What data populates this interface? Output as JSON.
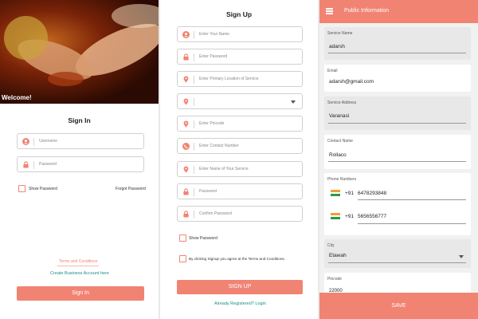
{
  "colors": {
    "accent": "#f18373",
    "link": "#1a8f86"
  },
  "signin": {
    "welcome": "Welcome!",
    "title": "Sign In",
    "username_placeholder": "Username",
    "password_placeholder": "Password",
    "show_password": "Show Password",
    "forgot_password": "Forgot Password",
    "terms_link": "Terms and Conditions",
    "create_account": "Create Business Account here",
    "signin_button": "Sign In"
  },
  "signup": {
    "title": "Sign Up",
    "fields": [
      {
        "icon": "user-icon",
        "placeholder": "Enter Your Name"
      },
      {
        "icon": "lock-icon",
        "placeholder": "Enter Password"
      },
      {
        "icon": "location-pin-icon",
        "placeholder": "Enter Primary Location of Service"
      },
      {
        "icon": "location-pin-icon",
        "placeholder": ""
      },
      {
        "icon": "location-pin-icon",
        "placeholder": "Enter Pincode"
      },
      {
        "icon": "phone-icon",
        "placeholder": "Enter Contact Number"
      },
      {
        "icon": "location-pin-icon",
        "placeholder": "Enter Name of Your Service"
      },
      {
        "icon": "lock-icon",
        "placeholder": "Password"
      },
      {
        "icon": "lock-icon",
        "placeholder": "Confirm Password"
      }
    ],
    "show_password": "Show Password",
    "terms_text": "By clicking Signup you agree at the Terms and Conditions.",
    "signup_button": "SIGN UP",
    "already_registered": "Already Registered? Login"
  },
  "public_info": {
    "title": "Public Information",
    "service_name_label": "Service Name",
    "service_name": "adarsh",
    "email_label": "Email",
    "email": "adarsh@gmail.com",
    "service_address_label": "Service Address",
    "service_address": "Varanasi",
    "contact_name_label": "Contact Name",
    "contact_name": "Rollaco",
    "phone_label": "Phone Numbers",
    "phones": [
      {
        "code": "+91",
        "number": "6478293848"
      },
      {
        "code": "+91",
        "number": "5656556777"
      }
    ],
    "city_label": "City",
    "city": "Etawah",
    "pincode_label": "Pincode",
    "pincode_partial": "22000",
    "save_button": "SAVE"
  }
}
